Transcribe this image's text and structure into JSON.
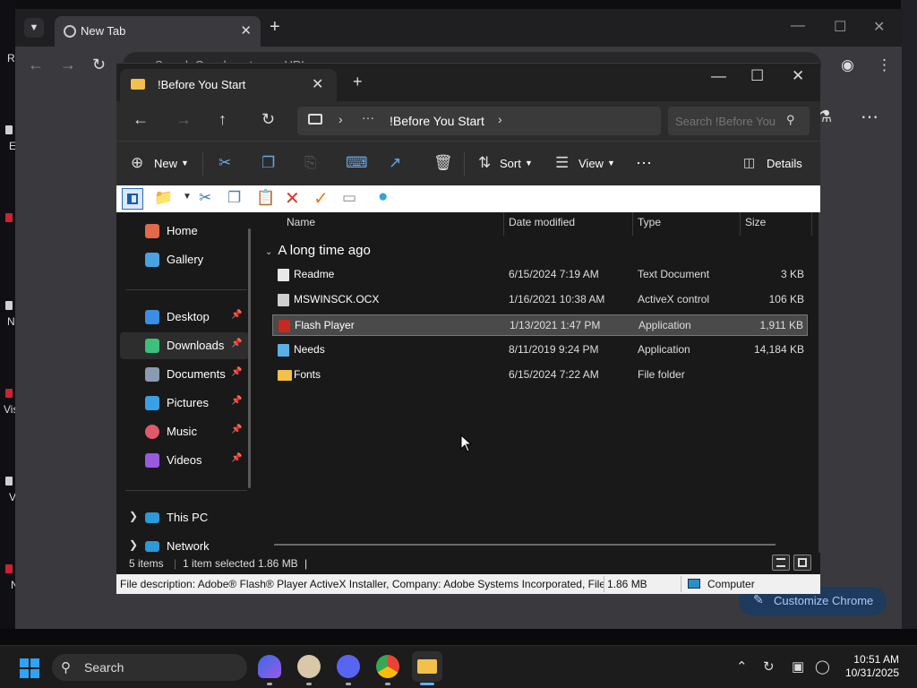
{
  "desktop": {
    "left_fragments": [
      "Re",
      "E",
      "N",
      "Vis",
      "V",
      "N"
    ]
  },
  "chrome": {
    "tab_title": "New Tab",
    "omnibox_placeholder": "Search Google or type a URL",
    "customize_label": "Customize Chrome"
  },
  "explorer": {
    "tab_title": "!Before You Start",
    "address": {
      "crumb": "!Before You Start"
    },
    "search_placeholder": "Search !Before You Start",
    "commands": {
      "new": "New",
      "sort": "Sort",
      "view": "View",
      "more": "···",
      "details": "Details"
    },
    "nav": {
      "quick": [
        {
          "label": "Home",
          "icon": "home-icon",
          "color": "#e06a4a"
        },
        {
          "label": "Gallery",
          "icon": "gallery-icon",
          "color": "#4aa3e0"
        }
      ],
      "pinned": [
        {
          "label": "Desktop",
          "icon": "desktop-icon",
          "color": "#3a8ee6"
        },
        {
          "label": "Downloads",
          "icon": "downloads-icon",
          "color": "#3cc07a"
        },
        {
          "label": "Documents",
          "icon": "documents-icon",
          "color": "#8a9ab0"
        },
        {
          "label": "Pictures",
          "icon": "pictures-icon",
          "color": "#3aa0e6"
        },
        {
          "label": "Music",
          "icon": "music-icon",
          "color": "#e05a6a"
        },
        {
          "label": "Videos",
          "icon": "videos-icon",
          "color": "#9a5ae0"
        }
      ],
      "tree": [
        {
          "label": "This PC",
          "icon": "this-pc-icon",
          "color": "#2a9ad8"
        },
        {
          "label": "Network",
          "icon": "network-icon",
          "color": "#2a9ad8"
        }
      ]
    },
    "columns": {
      "name": "Name",
      "date": "Date modified",
      "type": "Type",
      "size": "Size"
    },
    "group_label": "A long time ago",
    "files": [
      {
        "name": "Readme",
        "date": "6/15/2024 7:19 AM",
        "type": "Text Document",
        "size": "3 KB",
        "icon": "text-file-icon",
        "color": "#e8e8e8"
      },
      {
        "name": "MSWINSCK.OCX",
        "date": "1/16/2021 10:38 AM",
        "type": "ActiveX control",
        "size": "106 KB",
        "icon": "ocx-file-icon",
        "color": "#cfcfcf"
      },
      {
        "name": "Flash Player",
        "date": "1/13/2021 1:47 PM",
        "type": "Application",
        "size": "1,911 KB",
        "icon": "flash-app-icon",
        "color": "#c8281e"
      },
      {
        "name": "Needs",
        "date": "8/11/2019 9:24 PM",
        "type": "Application",
        "size": "14,184 KB",
        "icon": "app-icon",
        "color": "#5ab0e6"
      },
      {
        "name": "Fonts",
        "date": "6/15/2024 7:22 AM",
        "type": "File folder",
        "size": "",
        "icon": "folder-icon",
        "color": "#f3c14a"
      }
    ],
    "status": {
      "count": "5 items",
      "selected": "1 item selected",
      "size": "1.86 MB"
    },
    "description_bar": {
      "text": "File description: Adobe® Flash® Player ActiveX Installer, Company: Adobe Systems Incorporated, File v",
      "size": "1.86 MB",
      "location": "Computer"
    }
  },
  "taskbar": {
    "search_label": "Search",
    "time": "10:51 AM",
    "date": "10/31/2025"
  }
}
